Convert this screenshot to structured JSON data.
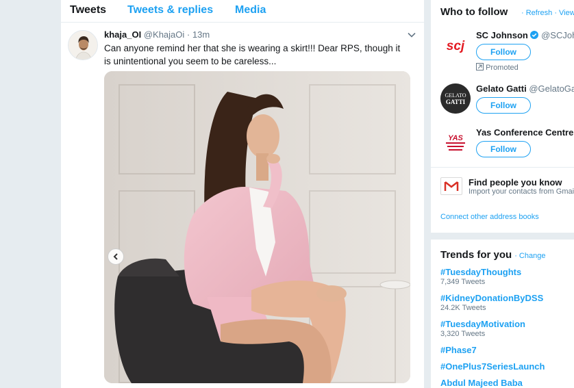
{
  "tabs": [
    {
      "label": "Tweets"
    },
    {
      "label": "Tweets & replies"
    },
    {
      "label": "Media"
    }
  ],
  "tweet": {
    "name": "khaja_OI",
    "handle": "@KhajaOi",
    "dot": "·",
    "time": "13m",
    "text": "Can anyone remind her that she is wearing a skirt!!! Dear RPS, though it is unintentional you seem to be careless..."
  },
  "who_to_follow": {
    "title": "Who to follow",
    "refresh": "· Refresh",
    "view_all": "· View all",
    "suggestions": [
      {
        "name": "SC Johnson",
        "handle": "@SCJohns",
        "follow": "Follow",
        "promoted": "Promoted",
        "logo_text": "scj"
      },
      {
        "name": "Gelato Gatti",
        "handle": "@GelatoGat",
        "follow": "Follow",
        "logo_text": "GELATO GATTI"
      },
      {
        "name": "Yas Conference Centre",
        "handle": "@",
        "follow": "Follow",
        "logo_text": "YAS"
      }
    ],
    "find_title": "Find people you know",
    "find_sub": "Import your contacts from Gmail",
    "connect": "Connect other address books"
  },
  "trends": {
    "title": "Trends for you",
    "change": "· Change",
    "items": [
      {
        "tag": "#TuesdayThoughts",
        "count": "7,349 Tweets"
      },
      {
        "tag": "#KidneyDonationByDSS",
        "count": "24.2K Tweets"
      },
      {
        "tag": "#TuesdayMotivation",
        "count": "3,320 Tweets"
      },
      {
        "tag": "#Phase7",
        "count": ""
      },
      {
        "tag": "#OnePlus7SeriesLaunch",
        "count": ""
      },
      {
        "tag": "Abdul Majeed Baba",
        "count": ""
      }
    ]
  },
  "colors": {
    "accent": "#1da1f2",
    "text": "#14171a",
    "muted": "#657786",
    "scj_red": "#e31b23"
  }
}
